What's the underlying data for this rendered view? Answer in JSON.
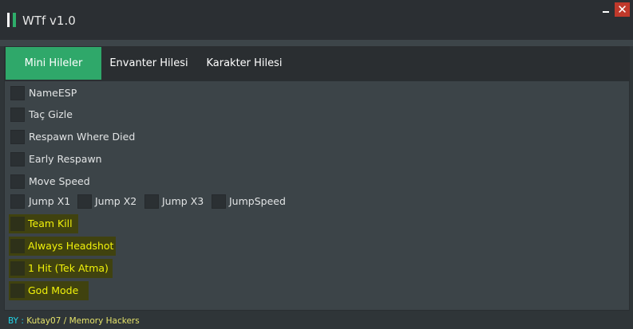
{
  "window": {
    "title": "WTf v1.0",
    "close_glyph": "✕",
    "icons": {
      "minimize": "minimize-icon",
      "close": "close-icon",
      "logo": "logo-icon"
    }
  },
  "tabs": [
    {
      "label": "Mini Hileler",
      "active": true
    },
    {
      "label": "Envanter Hilesi",
      "active": false
    },
    {
      "label": "Karakter Hilesi",
      "active": false
    }
  ],
  "options": {
    "name_esp": {
      "label": "NameESP",
      "checked": false
    },
    "tac_gizle": {
      "label": "Taç Gizle",
      "checked": false
    },
    "respawn_where_died": {
      "label": "Respawn Where Died",
      "checked": false
    },
    "early_respawn": {
      "label": "Early Respawn",
      "checked": false
    },
    "move_speed": {
      "label": "Move Speed",
      "checked": false
    },
    "jump_x1": {
      "label": "Jump X1",
      "checked": false
    },
    "jump_x2": {
      "label": "Jump X2",
      "checked": false
    },
    "jump_x3": {
      "label": "Jump X3",
      "checked": false
    },
    "jump_speed": {
      "label": "JumpSpeed",
      "checked": false
    },
    "team_kill": {
      "label": "Team Kill",
      "checked": false,
      "highlighted": true
    },
    "always_headshot": {
      "label": "Always Headshot",
      "checked": false,
      "highlighted": true
    },
    "one_hit": {
      "label": "1 Hit (Tek Atma)",
      "checked": false,
      "highlighted": true
    },
    "god_mode": {
      "label": "God Mode",
      "checked": false,
      "highlighted": true
    }
  },
  "footer": {
    "by": "BY :",
    "author": "Kutay07 / Memory Hackers"
  },
  "colors": {
    "accent": "#2fa86a",
    "background": "#2f3538",
    "panel": "#3c4448",
    "highlight": "#40420f",
    "highlight_text": "#f1f20a",
    "footer_by": "#22d3e6",
    "footer_author": "#e5e36a",
    "close": "#c0392b"
  }
}
